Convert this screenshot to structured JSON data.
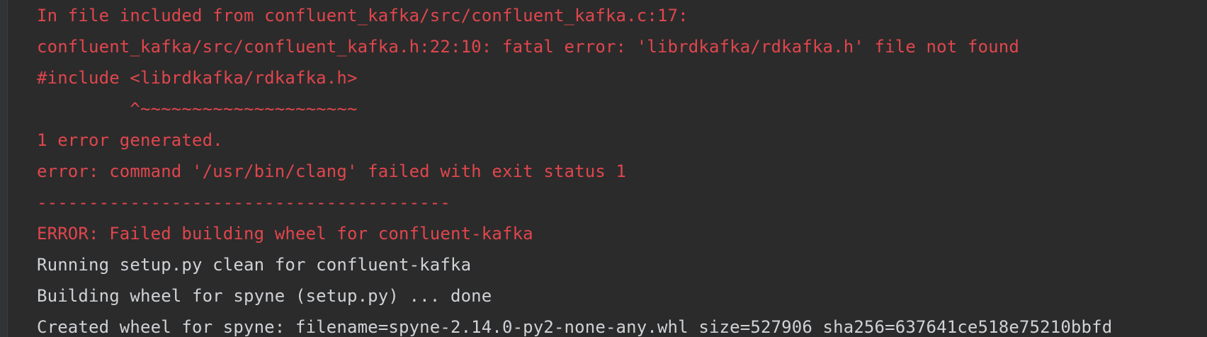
{
  "console": {
    "lines": [
      {
        "type": "error",
        "text": "In file included from confluent_kafka/src/confluent_kafka.c:17:"
      },
      {
        "type": "error",
        "text": "confluent_kafka/src/confluent_kafka.h:22:10: fatal error: 'librdkafka/rdkafka.h' file not found"
      },
      {
        "type": "error",
        "text": "#include <librdkafka/rdkafka.h>"
      },
      {
        "type": "error",
        "text": "         ^~~~~~~~~~~~~~~~~~~~~~"
      },
      {
        "type": "error",
        "text": "1 error generated."
      },
      {
        "type": "error",
        "text": "error: command '/usr/bin/clang' failed with exit status 1"
      },
      {
        "type": "error",
        "text": "----------------------------------------"
      },
      {
        "type": "error",
        "text": "ERROR: Failed building wheel for confluent-kafka"
      },
      {
        "type": "normal",
        "text": "Running setup.py clean for confluent-kafka"
      },
      {
        "type": "normal",
        "text": "Building wheel for spyne (setup.py) ... done"
      },
      {
        "type": "normal",
        "text": "Created wheel for spyne: filename=spyne-2.14.0-py2-none-any.whl size=527906 sha256=637641ce518e75210bbfd"
      }
    ]
  },
  "colors": {
    "background": "#2b2b2b",
    "error_text": "#e0464d",
    "normal_text": "#cfd2d6"
  }
}
